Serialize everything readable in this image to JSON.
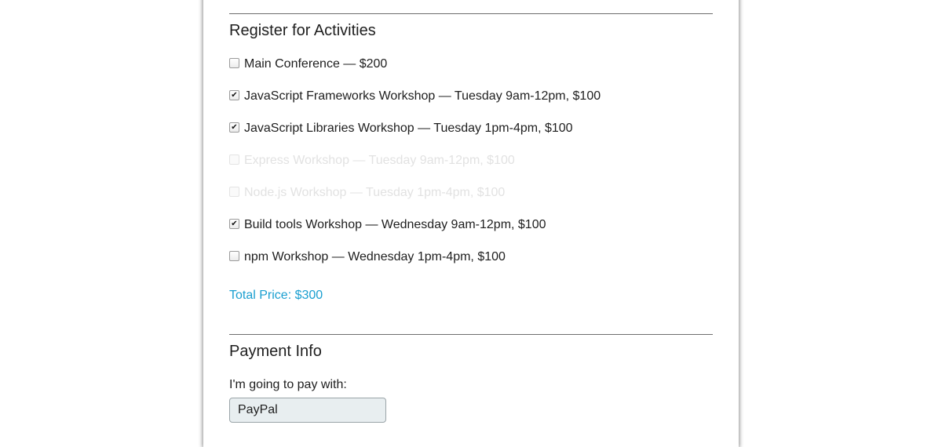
{
  "activities_section": {
    "title": "Register for Activities",
    "items": [
      {
        "label": "Main Conference — $200",
        "checked": false,
        "disabled": false
      },
      {
        "label": "JavaScript Frameworks Workshop — Tuesday 9am-12pm, $100",
        "checked": true,
        "disabled": false
      },
      {
        "label": "JavaScript Libraries Workshop — Tuesday 1pm-4pm, $100",
        "checked": true,
        "disabled": false
      },
      {
        "label": "Express Workshop — Tuesday 9am-12pm, $100",
        "checked": false,
        "disabled": true
      },
      {
        "label": "Node.js Workshop — Tuesday 1pm-4pm, $100",
        "checked": false,
        "disabled": true
      },
      {
        "label": "Build tools Workshop — Wednesday 9am-12pm, $100",
        "checked": true,
        "disabled": false
      },
      {
        "label": "npm Workshop — Wednesday 1pm-4pm, $100",
        "checked": false,
        "disabled": false
      }
    ],
    "total_price": "Total Price: $300",
    "total_color": "#1a9fd0"
  },
  "payment_section": {
    "title": "Payment Info",
    "pay_label": "I'm going to pay with:",
    "payment_select_value": "PayPal"
  }
}
